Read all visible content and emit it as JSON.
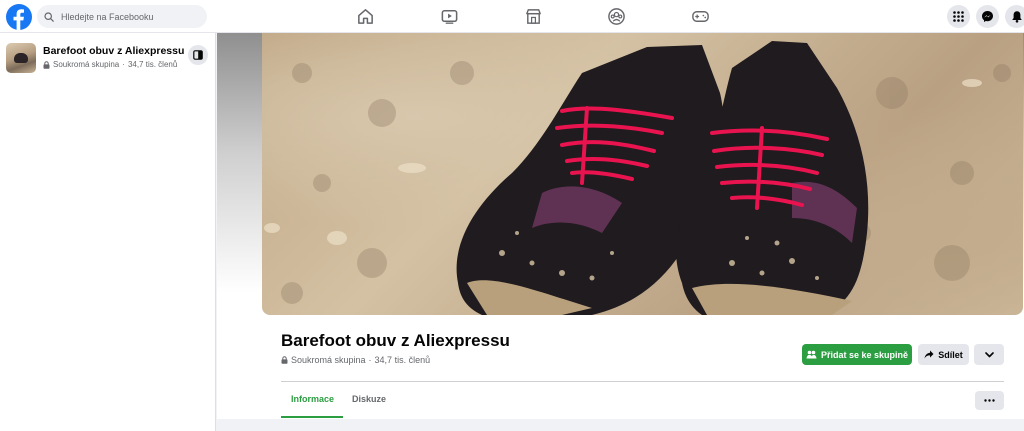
{
  "topbar": {
    "search": {
      "placeholder": "Hledejte na Facebooku"
    },
    "nav_icons": [
      "home-icon",
      "video-icon",
      "marketplace-icon",
      "groups-icon",
      "gaming-icon"
    ],
    "right_icons": [
      "menu-grid-icon",
      "messenger-icon",
      "notifications-icon"
    ]
  },
  "sidebar": {
    "group_name": "Barefoot obuv z Aliexpressu",
    "privacy": "Soukromá skupina",
    "separator": "·",
    "members": "34,7 tis. členů"
  },
  "group": {
    "name": "Barefoot obuv z Aliexpressu",
    "privacy": "Soukromá skupina",
    "separator": "·",
    "members": "34,7 tis. členů",
    "join_label": "Přidat se ke skupině",
    "share_label": "Sdílet"
  },
  "tabs": [
    {
      "label": "Informace",
      "active": true
    },
    {
      "label": "Diskuze",
      "active": false
    }
  ],
  "colors": {
    "brand_blue": "#1877f2",
    "join_green": "#2c9e42",
    "cover_shoe": "#1f1b1e",
    "laces": "#e8134f"
  }
}
